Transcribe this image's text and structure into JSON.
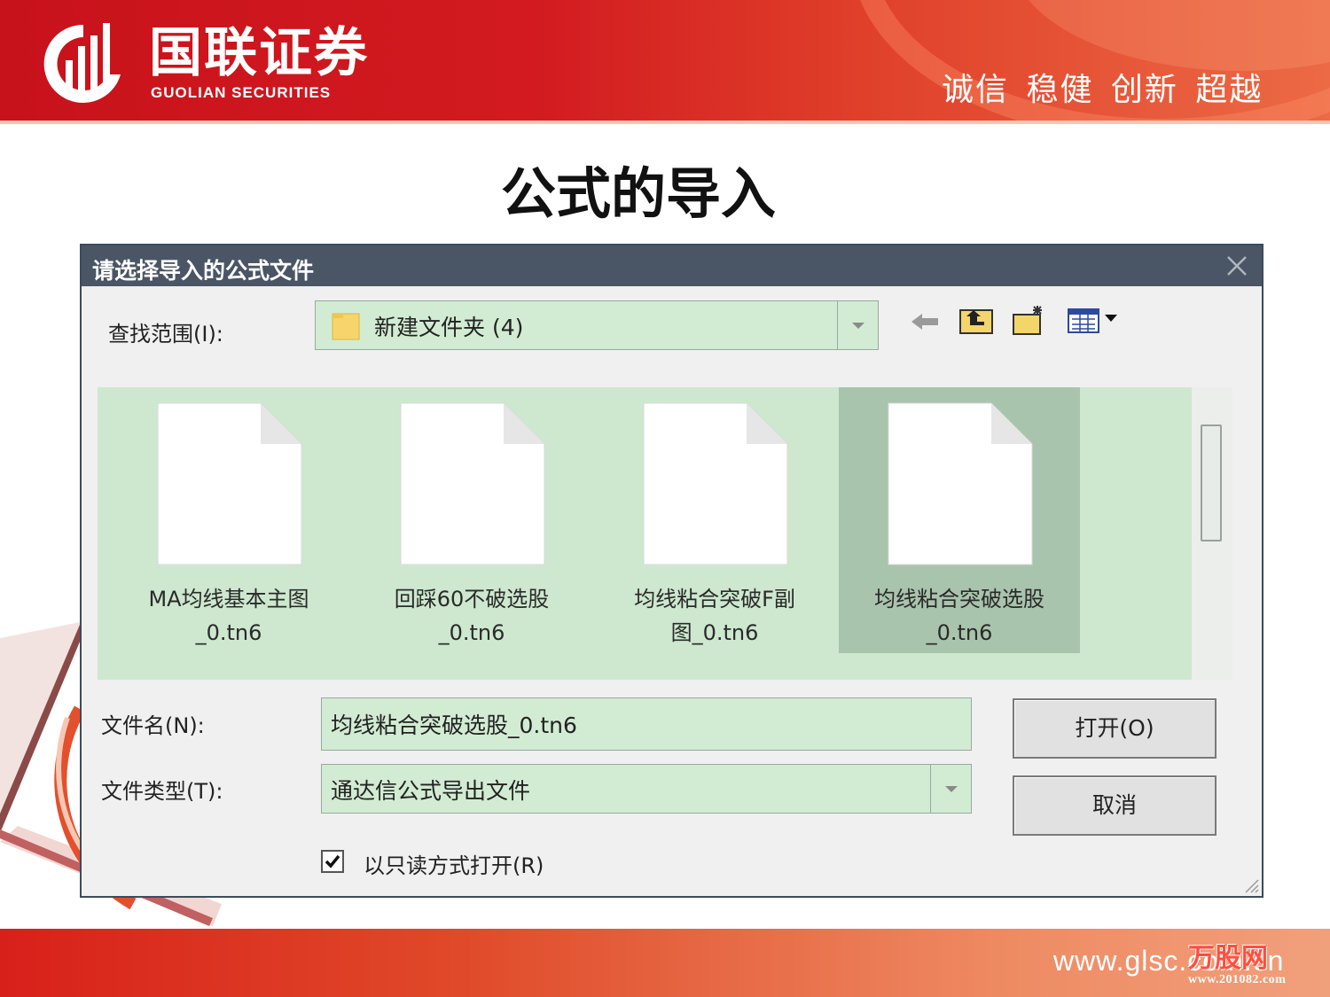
{
  "banner": {
    "logo_cn": "国联证券",
    "logo_en": "GUOLIAN SECURITIES",
    "slogan": "诚信 稳健 创新 超越"
  },
  "slide": {
    "title": "公式的导入"
  },
  "dialog": {
    "title": "请选择导入的公式文件",
    "lookin_label": "查找范围(I):",
    "lookin_value": "新建文件夹 (4)",
    "files": [
      {
        "name": "MA均线基本主图_0.tn6",
        "line1": "MA均线基本主图",
        "line2": "_0.tn6",
        "selected": false
      },
      {
        "name": "回踩60不破选股_0.tn6",
        "line1": "回踩60不破选股",
        "line2": "_0.tn6",
        "selected": false
      },
      {
        "name": "均线粘合突破F副图_0.tn6",
        "line1": "均线粘合突破F副",
        "line2": "图_0.tn6",
        "selected": false
      },
      {
        "name": "均线粘合突破选股_0.tn6",
        "line1": "均线粘合突破选股",
        "line2": "_0.tn6",
        "selected": true
      }
    ],
    "filename_label": "文件名(N):",
    "filename_value": "均线粘合突破选股_0.tn6",
    "filetype_label": "文件类型(T):",
    "filetype_value": "通达信公式导出文件",
    "open_button": "打开(O)",
    "cancel_button": "取消",
    "readonly_label": "以只读方式打开(R)",
    "readonly_checked": true
  },
  "footer": {
    "url": "www.glsc.com.cn",
    "watermark_brand": "万股网",
    "watermark_url": "www.201082.com"
  },
  "colors": {
    "brand_red": "#c8121b",
    "dialog_title_bg": "#4a5665",
    "field_green": "#d2ecd3",
    "selected_item": "#a9c4ad"
  }
}
